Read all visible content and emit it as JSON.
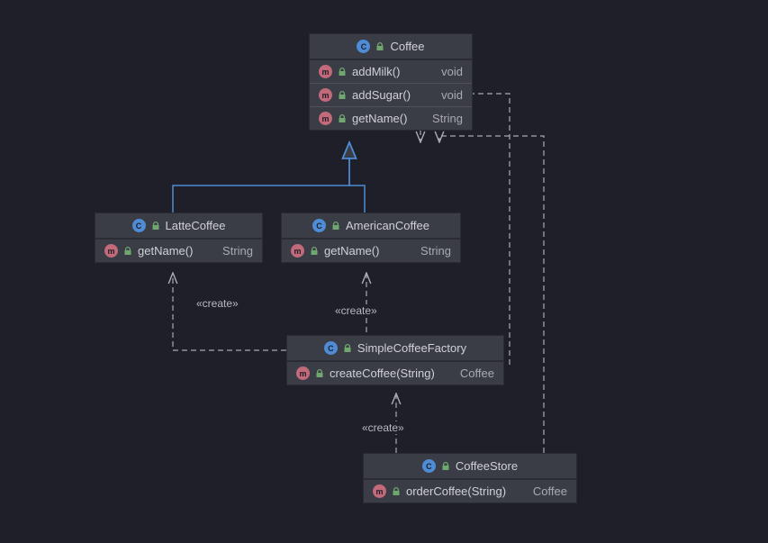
{
  "classes": {
    "coffee": {
      "title": "Coffee",
      "members": [
        {
          "name": "addMilk()",
          "ret": "void"
        },
        {
          "name": "addSugar()",
          "ret": "void"
        },
        {
          "name": "getName()",
          "ret": "String"
        }
      ]
    },
    "latte": {
      "title": "LatteCoffee",
      "members": [
        {
          "name": "getName()",
          "ret": "String"
        }
      ]
    },
    "american": {
      "title": "AmericanCoffee",
      "members": [
        {
          "name": "getName()",
          "ret": "String"
        }
      ]
    },
    "factory": {
      "title": "SimpleCoffeeFactory",
      "members": [
        {
          "name": "createCoffee(String)",
          "ret": "Coffee"
        }
      ]
    },
    "store": {
      "title": "CoffeeStore",
      "members": [
        {
          "name": "orderCoffee(String)",
          "ret": "Coffee"
        }
      ]
    }
  },
  "stereos": {
    "s1": "«create»",
    "s2": "«create»",
    "s3": "«create»"
  }
}
